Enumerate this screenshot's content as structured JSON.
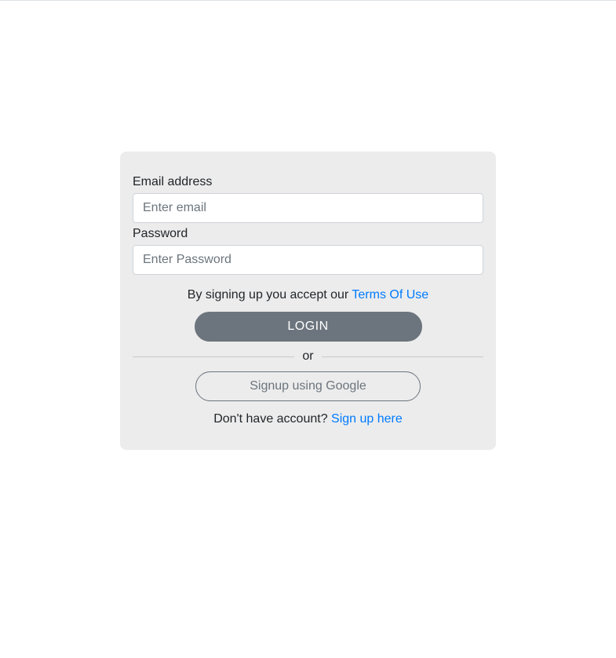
{
  "form": {
    "email_label": "Email address",
    "email_placeholder": "Enter email",
    "email_value": "",
    "password_label": "Password",
    "password_placeholder": "Enter Password",
    "password_value": ""
  },
  "terms": {
    "prefix": "By signing up you accept our ",
    "link": "Terms Of Use"
  },
  "buttons": {
    "login": "LOGIN",
    "google": "Signup using Google"
  },
  "divider": {
    "text": "or"
  },
  "signup": {
    "prefix": "Don't have account? ",
    "link": "Sign up here"
  },
  "colors": {
    "card_bg": "#ececec",
    "link": "#007bff",
    "btn_secondary": "#6c757d",
    "input_border": "#ced4da"
  }
}
